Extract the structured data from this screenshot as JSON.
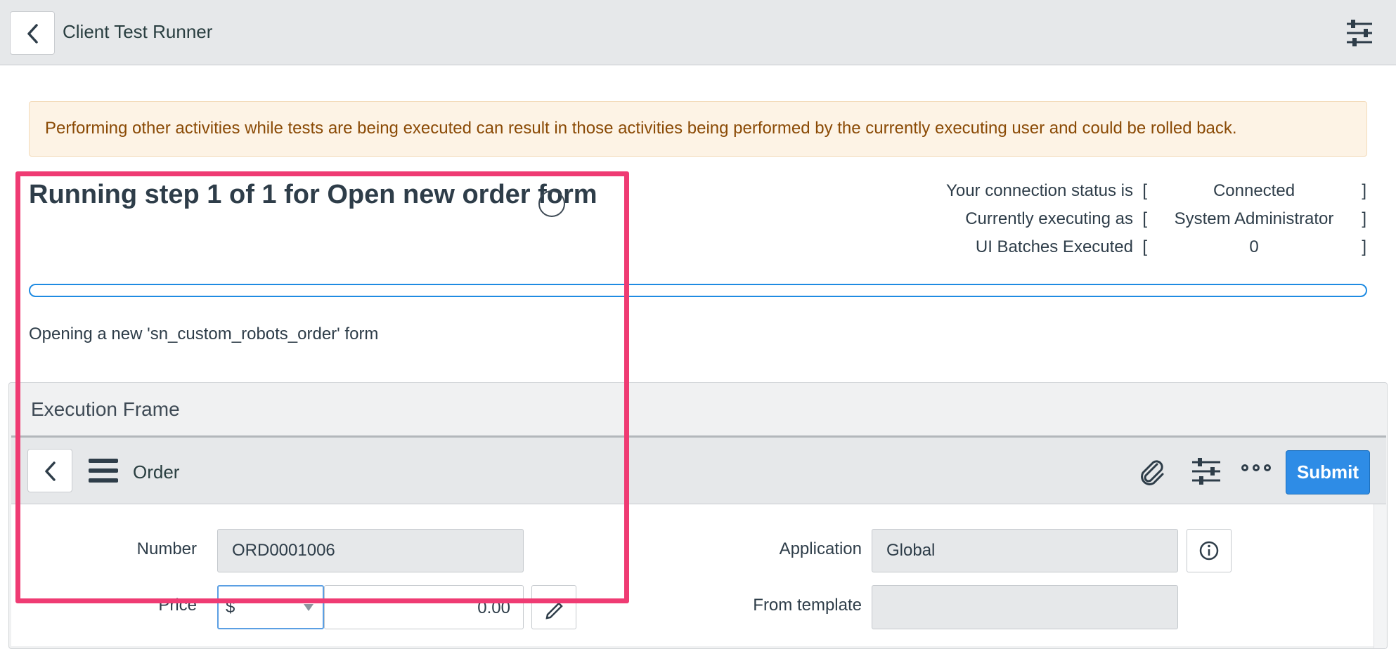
{
  "header": {
    "title": "Client Test Runner",
    "back_icon": "chevron-left-icon",
    "settings_icon": "sliders-icon"
  },
  "warning": {
    "text": "Performing other activities while tests are being executed can result in those activities being performed by the currently executing user and could be rolled back."
  },
  "run": {
    "title": "Running step 1 of 1 for Open new order form",
    "spinner_icon": "loading-spinner-icon",
    "message": "Opening a new 'sn_custom_robots_order' form",
    "progress_fraction": 0
  },
  "status": {
    "rows": [
      {
        "label": "Your connection status is",
        "open": "[",
        "value": "Connected",
        "close": "]"
      },
      {
        "label": "Currently executing as",
        "open": "[",
        "value": "System Administrator",
        "close": "]"
      },
      {
        "label": "UI Batches Executed",
        "open": "[",
        "value": "0",
        "close": "]"
      }
    ]
  },
  "execution_frame": {
    "title": "Execution Frame",
    "form": {
      "title": "Order",
      "submit_label": "Submit",
      "icons": [
        "chevron-left-icon",
        "hamburger-menu-icon",
        "paperclip-icon",
        "sliders-icon",
        "more-icon"
      ],
      "fields": {
        "number_label": "Number",
        "number_value": "ORD0001006",
        "price_label": "Price",
        "price_currency": "$",
        "price_value": "0.00",
        "application_label": "Application",
        "application_value": "Global",
        "from_template_label": "From template",
        "from_template_value": ""
      }
    }
  },
  "colors": {
    "accent": "#2e8ce6",
    "highlight": "#ef3b73",
    "warning_bg": "#fdf3e5",
    "warning_text": "#8a4a05"
  }
}
